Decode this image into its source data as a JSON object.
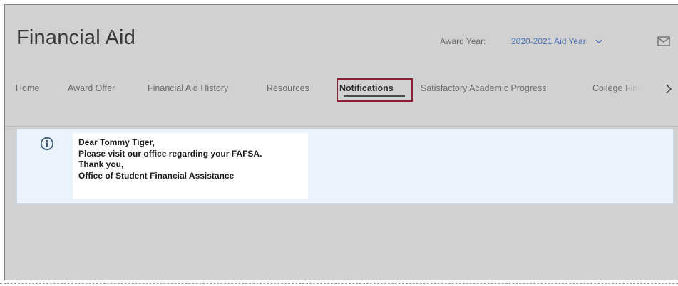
{
  "header": {
    "title": "Financial Aid",
    "award_year_label": "Award Year:",
    "award_year_value": "2020-2021 Aid Year"
  },
  "tabs": [
    {
      "label": "Home",
      "active": false
    },
    {
      "label": "Award Offer",
      "active": false
    },
    {
      "label": "Financial Aid History",
      "active": false
    },
    {
      "label": "Resources",
      "active": false
    },
    {
      "label": "Notifications",
      "active": true
    },
    {
      "label": "Satisfactory Academic Progress",
      "active": false
    },
    {
      "label": "College Fina",
      "active": false
    }
  ],
  "notification": {
    "icon": "info-icon",
    "lines": [
      "Dear Tommy Tiger,",
      "Please visit our office regarding your FAFSA.",
      "Thank you,",
      "Office of Student Financial Assistance"
    ]
  },
  "colors": {
    "active_tab_outline": "#8b1f2f",
    "link_blue": "#4a72b8",
    "notice_background": "#eaf3fb",
    "page_background": "#d1d1d1"
  }
}
